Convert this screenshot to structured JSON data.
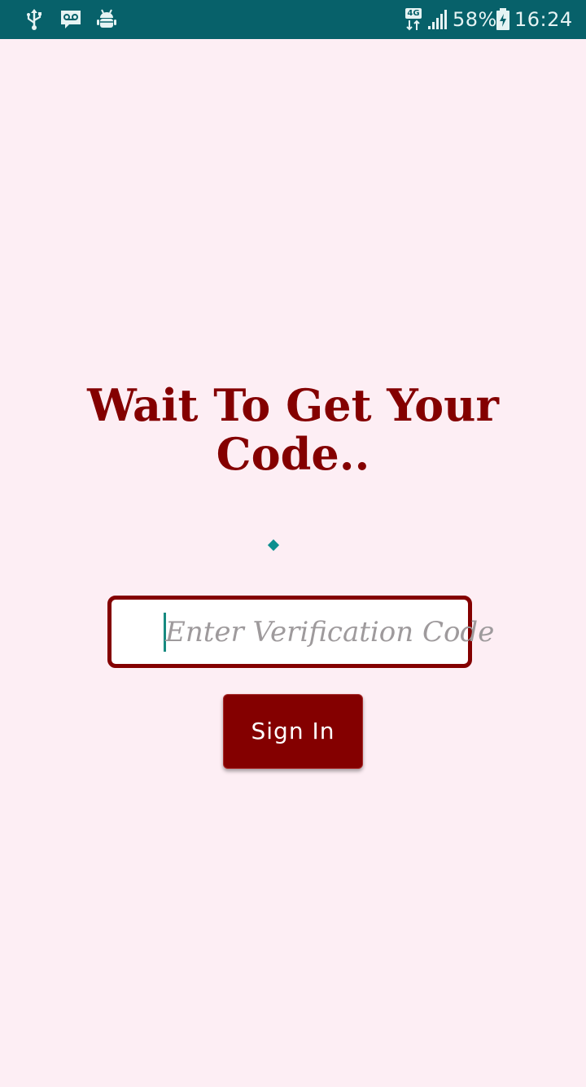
{
  "status_bar": {
    "background": "#07616a",
    "left_icons": [
      "usb-icon",
      "voicemail-icon",
      "android-debug-icon"
    ],
    "network_label": "4G",
    "battery_percent": "58%",
    "time": "16:24"
  },
  "main": {
    "title": "Wait To Get Your Code..",
    "code_input": {
      "placeholder": "Enter Verification Code",
      "value": ""
    },
    "sign_in_label": "Sign In"
  },
  "colors": {
    "accent": "#840000",
    "background": "#fdeef4",
    "progress": "#0c8f8f"
  }
}
